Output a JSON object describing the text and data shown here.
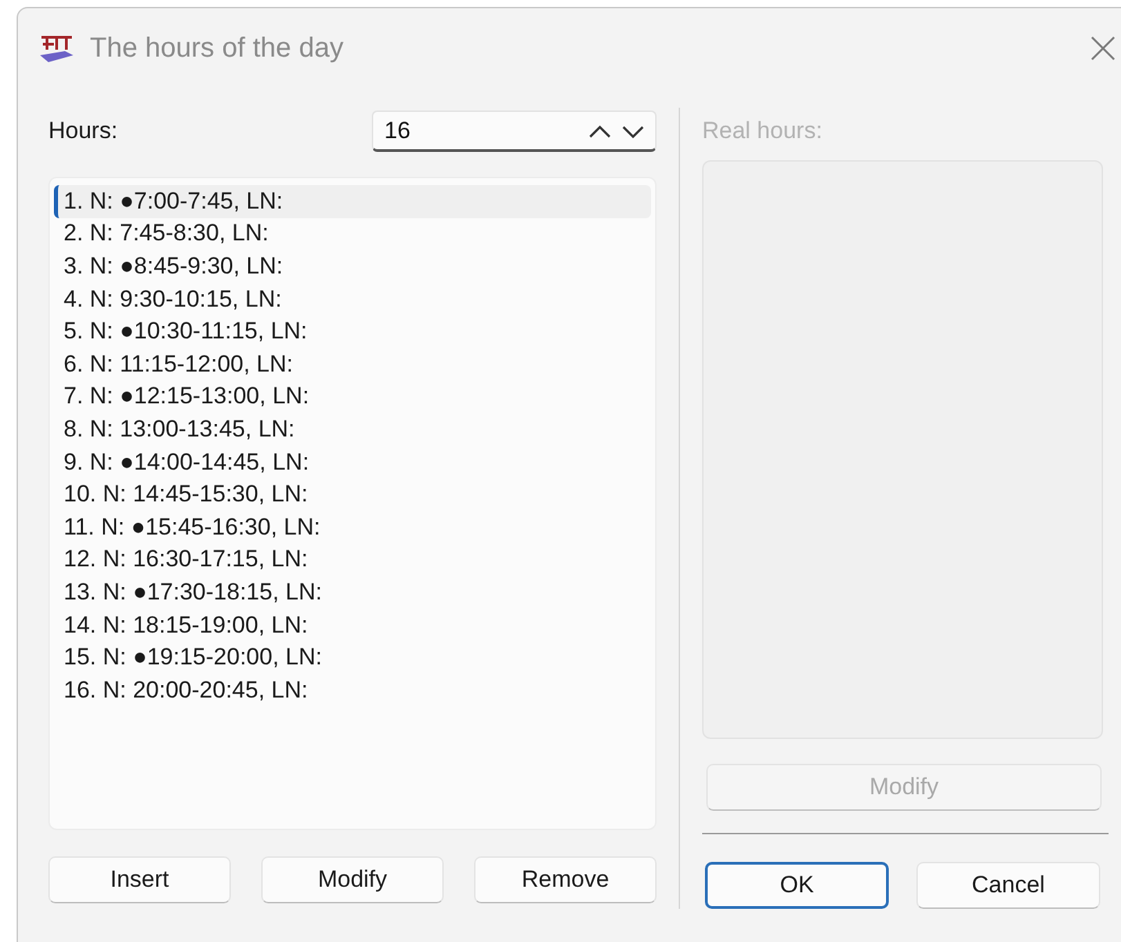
{
  "window": {
    "title": "The hours of the day"
  },
  "hours": {
    "label": "Hours:",
    "value": "16"
  },
  "list": [
    {
      "text": "1. N: ●7:00-7:45, LN:",
      "selected": true
    },
    {
      "text": "2. N: 7:45-8:30, LN:",
      "selected": false
    },
    {
      "text": "3. N: ●8:45-9:30, LN:",
      "selected": false
    },
    {
      "text": "4. N: 9:30-10:15, LN:",
      "selected": false
    },
    {
      "text": "5. N: ●10:30-11:15, LN:",
      "selected": false
    },
    {
      "text": "6. N: 11:15-12:00, LN:",
      "selected": false
    },
    {
      "text": "7. N: ●12:15-13:00, LN:",
      "selected": false
    },
    {
      "text": "8. N: 13:00-13:45, LN:",
      "selected": false
    },
    {
      "text": "9. N: ●14:00-14:45, LN:",
      "selected": false
    },
    {
      "text": "10. N: 14:45-15:30, LN:",
      "selected": false
    },
    {
      "text": "11. N: ●15:45-16:30, LN:",
      "selected": false
    },
    {
      "text": "12. N: 16:30-17:15, LN:",
      "selected": false
    },
    {
      "text": "13. N: ●17:30-18:15, LN:",
      "selected": false
    },
    {
      "text": "14. N: 18:15-19:00, LN:",
      "selected": false
    },
    {
      "text": "15. N: ●19:15-20:00, LN:",
      "selected": false
    },
    {
      "text": "16. N: 20:00-20:45, LN:",
      "selected": false
    }
  ],
  "list_buttons": [
    {
      "label": "Insert"
    },
    {
      "label": "Modify"
    },
    {
      "label": "Remove"
    }
  ],
  "real_hours": {
    "label": "Real hours:",
    "disabled": true,
    "button": {
      "label": "Modify",
      "disabled": true
    }
  },
  "dialog_buttons": [
    {
      "label": "OK",
      "default": true
    },
    {
      "label": "Cancel",
      "default": false
    }
  ]
}
